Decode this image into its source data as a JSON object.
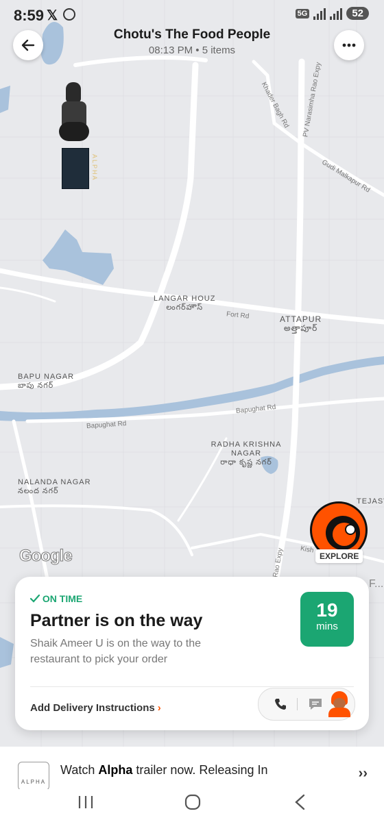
{
  "status_bar": {
    "time": "8:59",
    "network": "5G",
    "battery": "52"
  },
  "header": {
    "title": "Chotu's The Food People",
    "subtitle": "08:13 PM • 5 items"
  },
  "map": {
    "labels": {
      "langar_houz": "LANGAR HOUZ",
      "langar_houz_te": "లంగర్‌హౌస్",
      "attapur": "ATTAPUR",
      "attapur_te": "అత్తాపూర్",
      "bapu_nagar": "BAPU NAGAR",
      "bapu_nagar_te": "బాపు నగర్",
      "radha_krishna_nagar": "RADHA KRISHNA NAGAR",
      "radha_krishna_nagar_te": "రాధా కృష్ణ నగర్",
      "nalanda_nagar": "NALANDA NAGAR",
      "nalanda_nagar_te": "నలంద నగర్",
      "tejasw": "TEJASW"
    },
    "roads": {
      "khader_bagh": "Khader Bagh Rd",
      "pv_narasimha": "PV Narasimha Rao Expy",
      "gudi_malkapur": "Gudi Malkapur Rd",
      "fort_rd": "Fort Rd",
      "bapughat_1": "Bapughat Rd",
      "bapughat_2": "Bapughat Rd",
      "kish": "Kish",
      "rao_expy": "Rao Expy"
    },
    "google_logo": "Google",
    "ad_sign": "ALPHA",
    "explore_label": "EXPLORE",
    "cut_text": "F..."
  },
  "order_card": {
    "status": "ON TIME",
    "title": "Partner is on the way",
    "description": "Shaik Ameer U is on the way to the restaurant to pick your order",
    "eta_value": "19",
    "eta_unit": "mins",
    "instructions": "Add Delivery Instructions"
  },
  "promo": {
    "logo_text": "ALPHA",
    "text_prefix": "Watch ",
    "text_bold": "Alpha",
    "text_suffix": " trailer now. Releasing In"
  },
  "colors": {
    "accent_green": "#1ba672",
    "brand_orange": "#ff5200",
    "map_bg": "#e8e9ec",
    "water": "#a9c2dc"
  },
  "icons": [
    "back-arrow-icon",
    "more-icon",
    "check-icon",
    "chevron-right-icon",
    "phone-icon",
    "chat-icon",
    "delivery-partner-avatar",
    "recents-icon",
    "home-icon",
    "back-icon"
  ]
}
